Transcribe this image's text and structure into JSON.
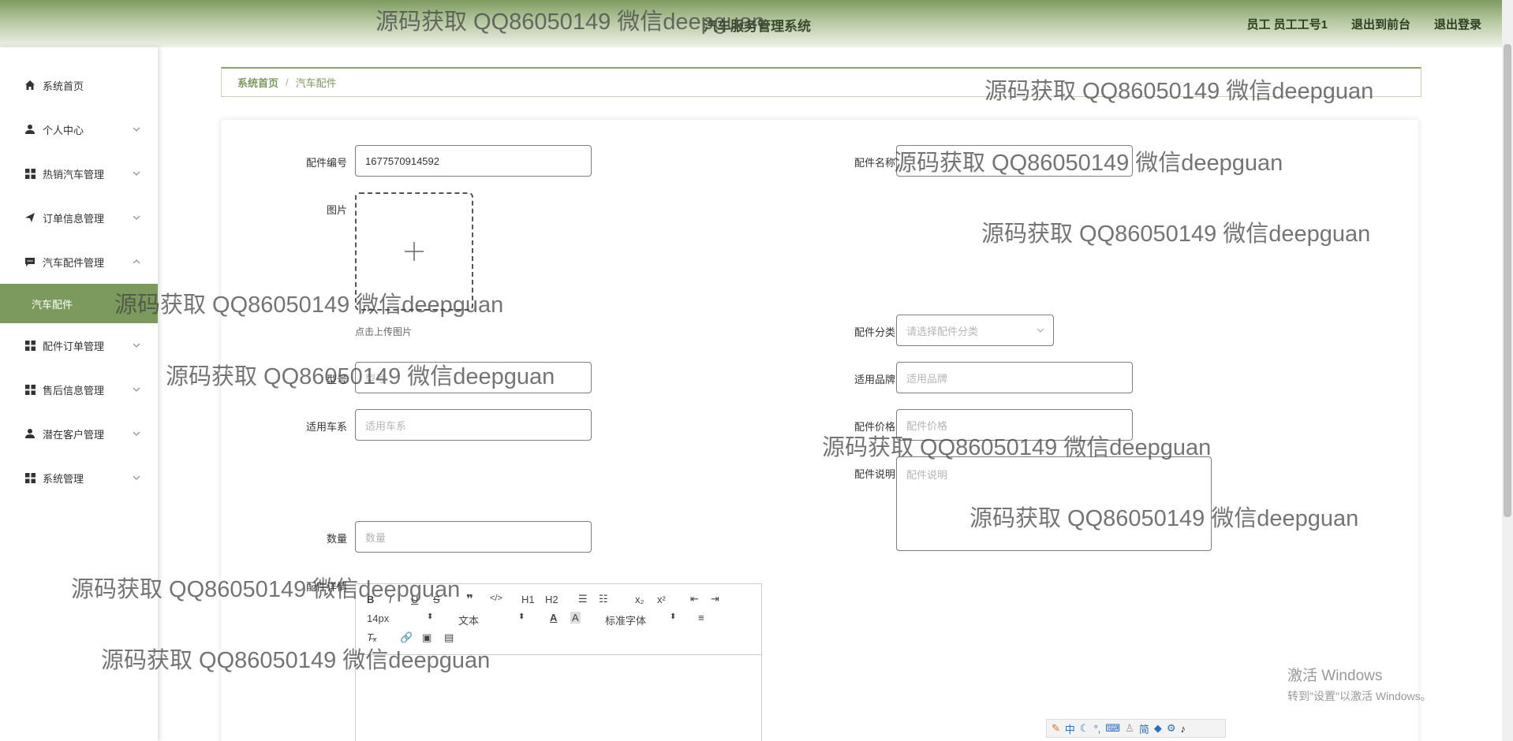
{
  "header": {
    "title": "汽车服务管理系统",
    "user": "员工 员工工号1",
    "to_front": "退出到前台",
    "logout": "退出登录"
  },
  "sidebar": {
    "items": [
      {
        "label": "系统首页",
        "icon": "home-icon"
      },
      {
        "label": "个人中心",
        "icon": "user-icon"
      },
      {
        "label": "热销汽车管理",
        "icon": "grid-icon"
      },
      {
        "label": "订单信息管理",
        "icon": "send-icon"
      },
      {
        "label": "汽车配件管理",
        "icon": "chat-icon"
      },
      {
        "label": "配件订单管理",
        "icon": "grid-icon"
      },
      {
        "label": "售后信息管理",
        "icon": "grid-icon"
      },
      {
        "label": "潜在客户管理",
        "icon": "user-icon"
      },
      {
        "label": "系统管理",
        "icon": "grid-icon"
      }
    ],
    "active_sub": "汽车配件"
  },
  "breadcrumb": {
    "home": "系统首页",
    "sep": "/",
    "current": "汽车配件"
  },
  "form": {
    "part_no_label": "配件编号",
    "part_no_value": "1677570914592",
    "part_name_label": "配件名称",
    "image_label": "图片",
    "upload_hint": "点击上传图片",
    "category_label": "配件分类",
    "category_placeholder": "请选择配件分类",
    "model_label": "型号",
    "model_placeholder": "型号",
    "brand_label": "适用品牌",
    "brand_placeholder": "适用品牌",
    "series_label": "适用车系",
    "series_placeholder": "适用车系",
    "price_label": "配件价格",
    "price_placeholder": "配件价格",
    "desc_label": "配件说明",
    "desc_placeholder": "配件说明",
    "qty_label": "数量",
    "qty_placeholder": "数量",
    "detail_label": "配件详情"
  },
  "editor": {
    "font_size": "14px",
    "text_style": "文本",
    "font_family": "标准字体",
    "h1": "H1",
    "h2": "H2"
  },
  "watermark": "源码获取 QQ86050149 微信deepguan",
  "windows": {
    "line1": "激活 Windows",
    "line2": "转到\"设置\"以激活 Windows。"
  },
  "ime": {
    "mode": "中",
    "simp": "简"
  }
}
